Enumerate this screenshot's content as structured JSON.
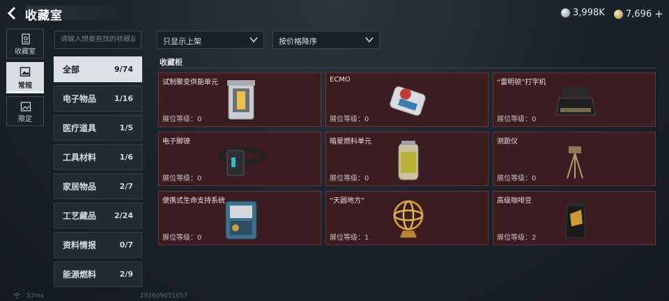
{
  "header": {
    "title": "收藏室"
  },
  "currency": [
    {
      "icon": "silver-coin-icon",
      "value": "3,998K"
    },
    {
      "icon": "gold-coin-icon",
      "value": "7,696",
      "add_label": "+"
    }
  ],
  "nav": [
    {
      "label": "收藏室",
      "icon": "vault-icon"
    },
    {
      "label": "常规",
      "icon": "picture-icon"
    },
    {
      "label": "限定",
      "icon": "image-frame-icon"
    }
  ],
  "search": {
    "placeholder": "请输入想要查找的收藏品"
  },
  "filters": {
    "shelf": "只显示上架",
    "sort": "按价格降序"
  },
  "categories": [
    {
      "name": "全部",
      "count": "9/74"
    },
    {
      "name": "电子物品",
      "count": "1/16"
    },
    {
      "name": "医疗道具",
      "count": "1/5"
    },
    {
      "name": "工具材料",
      "count": "1/6"
    },
    {
      "name": "家居物品",
      "count": "2/7"
    },
    {
      "name": "工艺藏品",
      "count": "2/24"
    },
    {
      "name": "资料情报",
      "count": "0/7"
    },
    {
      "name": "能源燃料",
      "count": "2/9"
    }
  ],
  "section_title": "收藏柜",
  "items": [
    {
      "name": "试制聚变供能单元",
      "level": "展位等级：0",
      "icon": "fusion-cell-icon"
    },
    {
      "name": "ECMO",
      "level": "展位等级：0",
      "icon": "ecmo-machine-icon"
    },
    {
      "name": "“雷明顿”打字机",
      "level": "展位等级：0",
      "icon": "typewriter-icon"
    },
    {
      "name": "电子脚镣",
      "level": "展位等级：0",
      "icon": "ankle-monitor-icon"
    },
    {
      "name": "暗星燃料单元",
      "level": "展位等级：0",
      "icon": "fuel-canister-icon"
    },
    {
      "name": "测距仪",
      "level": "展位等级：0",
      "icon": "rangefinder-tripod-icon"
    },
    {
      "name": "便携式生命支持系统",
      "level": "展位等级：0",
      "icon": "life-support-icon"
    },
    {
      "name": "“天圆地方”",
      "level": "展位等级：1",
      "icon": "armillary-sphere-icon"
    },
    {
      "name": "高级咖啡豆",
      "level": "展位等级：2",
      "icon": "coffee-bag-icon"
    }
  ],
  "footer": {
    "ping": "52ms",
    "build": "202609051057"
  }
}
